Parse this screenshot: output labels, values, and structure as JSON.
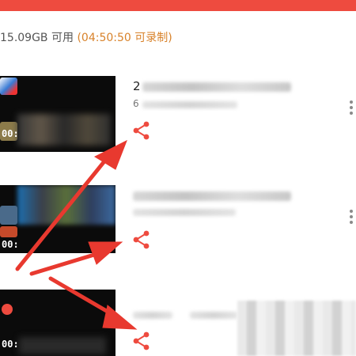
{
  "storage": {
    "free_text": "15.09GB 可用",
    "duration_text": "04:50:50 可录制"
  },
  "recordings": [
    {
      "thumb_timestamp": "00:",
      "title_first_char": "2",
      "size_first_char": "6"
    },
    {
      "thumb_timestamp": "00:",
      "title_first_char": "",
      "size_first_char": ""
    },
    {
      "thumb_timestamp": "00:",
      "title_first_char": "",
      "size_first_char": ""
    }
  ],
  "icons": {
    "share": "share-icon",
    "more": "more-vertical-icon",
    "record_dot": "record-dot-icon"
  },
  "colors": {
    "accent": "#ee4b3f",
    "duration": "#d8822a",
    "annotation_arrow": "#e8392f"
  }
}
